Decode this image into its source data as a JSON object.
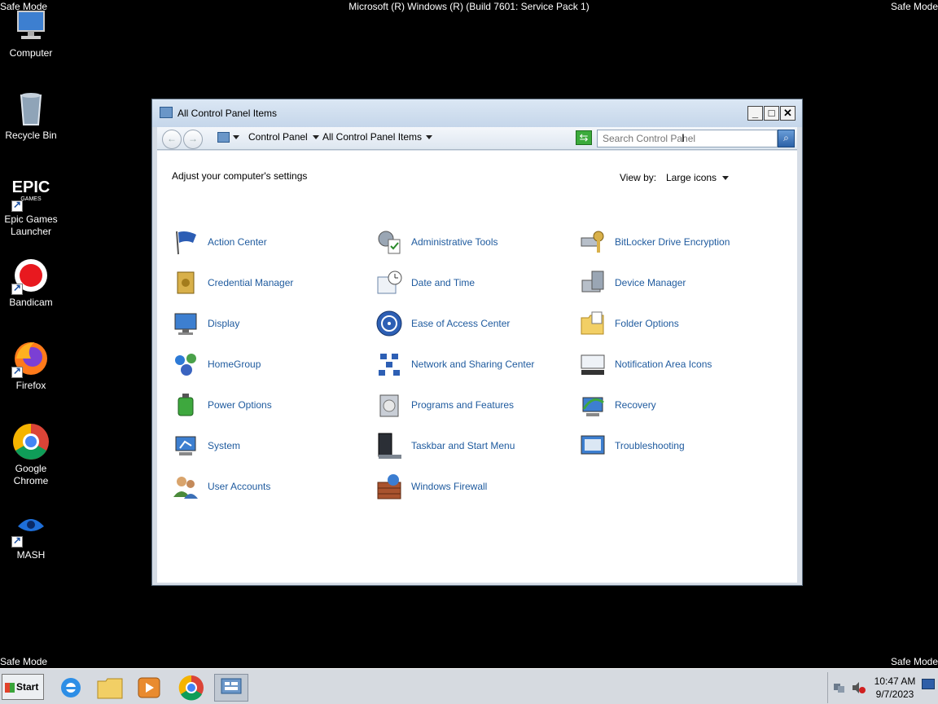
{
  "desktop": {
    "safe_mode_label": "Safe Mode",
    "build_text": "Microsoft (R) Windows (R) (Build 7601: Service Pack 1)",
    "icons": [
      {
        "label": "Computer",
        "icon": "computer-icon"
      },
      {
        "label": "Recycle Bin",
        "icon": "recycle-bin-icon"
      },
      {
        "label": "Epic Games Launcher",
        "icon": "epic-games-icon"
      },
      {
        "label": "Bandicam",
        "icon": "bandicam-icon"
      },
      {
        "label": "Firefox",
        "icon": "firefox-icon"
      },
      {
        "label": "Google Chrome",
        "icon": "chrome-icon"
      },
      {
        "label": "MASH",
        "icon": "mash-icon"
      }
    ]
  },
  "window": {
    "title": "All Control Panel Items",
    "controls": {
      "minimize": "_",
      "maximize": "□",
      "close": "✕"
    },
    "nav": {
      "breadcrumb": [
        "Control Panel",
        "All Control Panel Items"
      ],
      "search_placeholder": "Search Control Panel"
    },
    "heading": "Adjust your computer's settings",
    "view_by_label": "View by:",
    "view_by_value": "Large icons",
    "items": [
      {
        "label": "Action Center",
        "icon": "action-center-flag-icon"
      },
      {
        "label": "Administrative Tools",
        "icon": "administrative-tools-icon"
      },
      {
        "label": "BitLocker Drive Encryption",
        "icon": "bitlocker-icon"
      },
      {
        "label": "Credential Manager",
        "icon": "credential-manager-icon"
      },
      {
        "label": "Date and Time",
        "icon": "date-time-icon"
      },
      {
        "label": "Device Manager",
        "icon": "device-manager-icon"
      },
      {
        "label": "Display",
        "icon": "display-icon"
      },
      {
        "label": "Ease of Access Center",
        "icon": "ease-of-access-icon"
      },
      {
        "label": "Folder Options",
        "icon": "folder-options-icon"
      },
      {
        "label": "HomeGroup",
        "icon": "homegroup-icon"
      },
      {
        "label": "Network and Sharing Center",
        "icon": "network-sharing-icon"
      },
      {
        "label": "Notification Area Icons",
        "icon": "notification-area-icon"
      },
      {
        "label": "Power Options",
        "icon": "power-options-icon"
      },
      {
        "label": "Programs and Features",
        "icon": "programs-features-icon"
      },
      {
        "label": "Recovery",
        "icon": "recovery-icon"
      },
      {
        "label": "System",
        "icon": "system-icon"
      },
      {
        "label": "Taskbar and Start Menu",
        "icon": "taskbar-start-menu-icon"
      },
      {
        "label": "Troubleshooting",
        "icon": "troubleshooting-icon"
      },
      {
        "label": "User Accounts",
        "icon": "user-accounts-icon"
      },
      {
        "label": "Windows Firewall",
        "icon": "windows-firewall-icon"
      }
    ]
  },
  "taskbar": {
    "start_label": "Start",
    "apps": [
      "internet-explorer-icon",
      "file-explorer-icon",
      "media-player-icon",
      "chrome-icon",
      "control-panel-icon"
    ],
    "time": "10:47 AM",
    "date": "9/7/2023"
  },
  "colors": {
    "link": "#1e5a9e",
    "desktop": "#000000"
  }
}
